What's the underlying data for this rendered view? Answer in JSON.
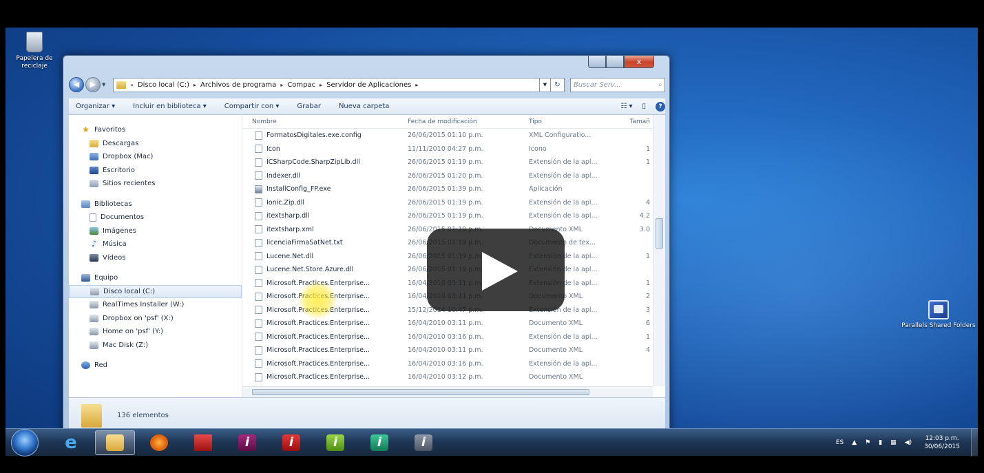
{
  "desktop": {
    "recycle_bin_label": "Papelera de reciclaje",
    "shared_folders_label": "Parallels Shared Folders"
  },
  "window": {
    "close_glyph": "x",
    "nav_back": "◀",
    "nav_forward": "▶",
    "address": {
      "segments": [
        "Disco local (C:)",
        "Archivos de programa",
        "Compac",
        "Servidor de Aplicaciones"
      ],
      "arrow": "▸",
      "lead_arrow": "«"
    },
    "refresh_glyph": "↻",
    "search_placeholder": "Buscar Serv...",
    "search_icon": "search-icon",
    "toolbar": {
      "organize": "Organizar ▾",
      "include_library": "Incluir en biblioteca ▾",
      "share_with": "Compartir con ▾",
      "burn": "Grabar",
      "new_folder": "Nueva carpeta",
      "views": "☷ ▾",
      "preview": "▯",
      "help": "?"
    },
    "nav": {
      "favorites": "Favoritos",
      "downloads": "Descargas",
      "dropbox_mac": "Dropbox (Mac)",
      "desktop": "Escritorio",
      "recent": "Sitios recientes",
      "libraries": "Bibliotecas",
      "documents": "Documentos",
      "images": "Imágenes",
      "music": "Música",
      "videos": "Vídeos",
      "computer": "Equipo",
      "local_disk": "Disco local (C:)",
      "realtimes": "RealTimes Installer (W:)",
      "dropbox_psf": "Dropbox on 'psf' (X:)",
      "home_psf": "Home on 'psf' (Y:)",
      "mac_disk": "Mac Disk (Z:)",
      "network": "Red"
    },
    "columns": {
      "name": "Nombre",
      "date": "Fecha de modificación",
      "type": "Tipo",
      "size": "Tamañ"
    },
    "files": [
      {
        "name": "FormatosDigitales.exe.config",
        "date": "26/06/2015 01:10 p.m.",
        "type": "XML Configuratio...",
        "size": ""
      },
      {
        "name": "Icon",
        "date": "11/11/2010 04:27 p.m.",
        "type": "Icono",
        "size": "1"
      },
      {
        "name": "ICSharpCode.SharpZipLib.dll",
        "date": "26/06/2015 01:19 p.m.",
        "type": "Extensión de la apl...",
        "size": "1"
      },
      {
        "name": "Indexer.dll",
        "date": "26/06/2015 01:20 p.m.",
        "type": "Extensión de la apl...",
        "size": ""
      },
      {
        "name": "InstallConfig_FP.exe",
        "date": "26/06/2015 01:39 p.m.",
        "type": "Aplicación",
        "size": ""
      },
      {
        "name": "Ionic.Zip.dll",
        "date": "26/06/2015 01:19 p.m.",
        "type": "Extensión de la apl...",
        "size": "4"
      },
      {
        "name": "itextsharp.dll",
        "date": "26/06/2015 01:19 p.m.",
        "type": "Extensión de la apl...",
        "size": "4.2"
      },
      {
        "name": "itextsharp.xml",
        "date": "26/06/2015 01:19 p.m.",
        "type": "Documento XML",
        "size": "3.0"
      },
      {
        "name": "licenciaFirmaSatNet.txt",
        "date": "26/06/2015 01:19 p.m.",
        "type": "Documento de tex...",
        "size": ""
      },
      {
        "name": "Lucene.Net.dll",
        "date": "26/06/2015 01:19 p.m.",
        "type": "Extensión de la apl...",
        "size": "1"
      },
      {
        "name": "Lucene.Net.Store.Azure.dll",
        "date": "26/06/2015 01:19 p.m.",
        "type": "Extensión de la apl...",
        "size": ""
      },
      {
        "name": "Microsoft.Practices.Enterprise...",
        "date": "16/04/2010 03:11 p.m.",
        "type": "Extensión de la apl...",
        "size": "1"
      },
      {
        "name": "Microsoft.Practices.Enterprise...",
        "date": "16/04/2010 03:11 p.m.",
        "type": "Documento XML",
        "size": "2"
      },
      {
        "name": "Microsoft.Practices.Enterprise...",
        "date": "15/12/2014 10:47 p.m.",
        "type": "Extensión de la apl...",
        "size": "3"
      },
      {
        "name": "Microsoft.Practices.Enterprise...",
        "date": "16/04/2010 03:11 p.m.",
        "type": "Documento XML",
        "size": "6"
      },
      {
        "name": "Microsoft.Practices.Enterprise...",
        "date": "16/04/2010 03:16 p.m.",
        "type": "Extensión de la apl...",
        "size": "1"
      },
      {
        "name": "Microsoft.Practices.Enterprise...",
        "date": "16/04/2010 03:11 p.m.",
        "type": "Documento XML",
        "size": "4"
      },
      {
        "name": "Microsoft.Practices.Enterprise...",
        "date": "16/04/2010 03:16 p.m.",
        "type": "Extensión de la apl...",
        "size": ""
      },
      {
        "name": "Microsoft.Practices.Enterprise...",
        "date": "16/04/2010 03:12 p.m.",
        "type": "Documento XML",
        "size": ""
      }
    ],
    "status": "136 elementos"
  },
  "taskbar": {
    "ie_glyph": "e",
    "app_glyph": "i",
    "tray": {
      "lang": "ES",
      "up_arrow": "▲",
      "clock_time": "12:03 p.m.",
      "clock_date": "30/06/2015"
    }
  },
  "colors": {
    "desktop_blue": "#1f62b8",
    "window_frame": "#aec6e2",
    "taskbar": "#1d3454",
    "highlight": "#ffe63c"
  }
}
